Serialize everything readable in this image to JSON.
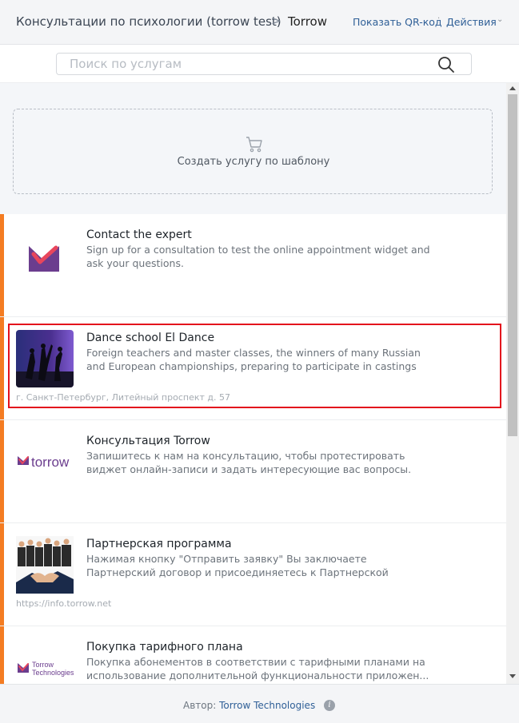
{
  "header": {
    "breadcrumb": "Консультации по психологии (torrow test)",
    "separator": ">",
    "current": "Torrow",
    "qr_link": "Показать QR-код",
    "dot": "·",
    "actions_link": "Действия",
    "actions_chevron": "⌄"
  },
  "search": {
    "placeholder": "Поиск по услугам",
    "icon": "search-icon"
  },
  "template": {
    "label": "Создать услугу по шаблону",
    "icon": "cart-icon"
  },
  "services": [
    {
      "title": "Contact the expert",
      "desc": "Sign up for a consultation to test the online appointment widget and ask your questions.",
      "address": "",
      "thumb": "torrow-logo-mark"
    },
    {
      "title": "Dance school El Dance",
      "desc": "Foreign teachers and master classes, the winners of many Russian and European championships, preparing to participate in castings f...",
      "address": "г. Санкт-Петербург, Литейный проспект д. 57",
      "thumb": "dance-photo",
      "highlighted": true
    },
    {
      "title": "Консультация Torrow",
      "desc": "Запишитесь к нам на консультацию, чтобы протестировать виджет онлайн-записи и задать интересующие вас вопросы.",
      "address": "",
      "thumb": "torrow-wordmark",
      "logo_text": "torrow"
    },
    {
      "title": "Партнерская программа",
      "desc": "Нажимая кнопку \"Отправить заявку\" Вы заключаете Партнерский договор и присоединяетесь к Партнерской программе...",
      "address": "https://info.torrow.net",
      "thumb": "handshake-photo"
    },
    {
      "title": "Покупка тарифного плана",
      "desc": "Покупка абонементов в соответствии с тарифными планами на использование дополнительной функциональности приложен...",
      "address": "",
      "thumb": "torrow-technologies-logo",
      "logo_text_1": "Torrow",
      "logo_text_2": "Technologies"
    }
  ],
  "footer": {
    "author_label": "Автор:",
    "author_name": "Torrow Technologies",
    "info_glyph": "i"
  },
  "colors": {
    "accent": "#f47c22",
    "link": "#2f5f97",
    "highlight": "#e3101c",
    "brand": "#6b3d8e"
  }
}
